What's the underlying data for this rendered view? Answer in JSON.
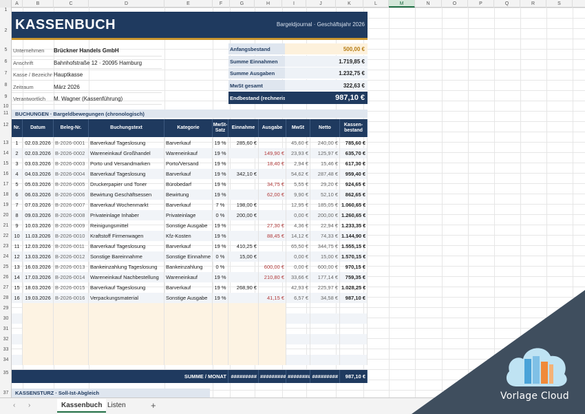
{
  "columns": [
    "A",
    "B",
    "C",
    "D",
    "E",
    "F",
    "G",
    "H",
    "I",
    "J",
    "K",
    "L",
    "M",
    "N",
    "O",
    "P",
    "Q",
    "R",
    "S"
  ],
  "active_column": "M",
  "rows_top": [
    "1",
    "2",
    "",
    "",
    "5",
    "6",
    "7",
    "8",
    "9",
    "10",
    "11",
    "12",
    "",
    "13",
    "14",
    "15",
    "16",
    "17",
    "18",
    "19",
    "20",
    "21",
    "22",
    "23",
    "24",
    "25",
    "26",
    "27",
    "28",
    "29",
    "30",
    "31",
    "32",
    "33",
    "34",
    "35",
    "",
    "37"
  ],
  "header": {
    "title": "KASSENBUCH",
    "subtitle": "Bargeldjournal · Geschäftsjahr 2026"
  },
  "info": [
    {
      "label": "Unternehmen",
      "value": "Brückner Handels GmbH",
      "bold": true
    },
    {
      "label": "Anschrift",
      "value": "Bahnhofstraße 12 · 20095 Hamburg",
      "bold": false
    },
    {
      "label": "Kasse / Bezeichn",
      "value": "Hauptkasse",
      "bold": false
    },
    {
      "label": "Zeitraum",
      "value": "März 2026",
      "bold": false
    },
    {
      "label": "Verantwortlich",
      "value": "M. Wagner (Kassenführung)",
      "bold": false
    }
  ],
  "summary": [
    {
      "label": "Anfangsbestand",
      "value": "500,00 €"
    },
    {
      "label": "Summe Einnahmen",
      "value": "1.719,85 €"
    },
    {
      "label": "Summe Ausgaben",
      "value": "1.232,75 €"
    },
    {
      "label": "MwSt gesamt",
      "value": "322,63 €"
    },
    {
      "label": "Endbestand (rechnerisch)",
      "value": "987,10 €"
    }
  ],
  "bookings_title": "BUCHUNGEN · Bargeldbewegungen (chronologisch)",
  "table_headers": [
    "Nr.",
    "Datum",
    "Beleg-Nr.",
    "Buchungstext",
    "Kategorie",
    "MwSt-Satz",
    "Einnahme",
    "Ausgabe",
    "MwSt",
    "Netto",
    "Kassen-bestand"
  ],
  "rows": [
    [
      "1",
      "02.03.2026",
      "B-2026-0001",
      "Barverkauf Tageslosung",
      "Barverkauf",
      "19 %",
      "285,60 €",
      "",
      "45,60 €",
      "240,00 €",
      "785,60 €"
    ],
    [
      "2",
      "02.03.2026",
      "B-2026-0002",
      "Wareneinkauf Großhandel",
      "Wareneinkauf",
      "19 %",
      "",
      "149,90 €",
      "23,93 €",
      "125,97 €",
      "635,70 €"
    ],
    [
      "3",
      "03.03.2026",
      "B-2026-0003",
      "Porto und Versandmarken",
      "Porto/Versand",
      "19 %",
      "",
      "18,40 €",
      "2,94 €",
      "15,46 €",
      "617,30 €"
    ],
    [
      "4",
      "04.03.2026",
      "B-2026-0004",
      "Barverkauf Tageslosung",
      "Barverkauf",
      "19 %",
      "342,10 €",
      "",
      "54,62 €",
      "287,48 €",
      "959,40 €"
    ],
    [
      "5",
      "05.03.2026",
      "B-2026-0005",
      "Druckerpapier und Toner",
      "Bürobedarf",
      "19 %",
      "",
      "34,75 €",
      "5,55 €",
      "29,20 €",
      "924,65 €"
    ],
    [
      "6",
      "06.03.2026",
      "B-2026-0006",
      "Bewirtung Geschäftsessen",
      "Bewirtung",
      "19 %",
      "",
      "62,00 €",
      "9,90 €",
      "52,10 €",
      "862,65 €"
    ],
    [
      "7",
      "07.03.2026",
      "B-2026-0007",
      "Barverkauf Wochenmarkt",
      "Barverkauf",
      "7 %",
      "198,00 €",
      "",
      "12,95 €",
      "185,05 €",
      "1.060,65 €"
    ],
    [
      "8",
      "09.03.2026",
      "B-2026-0008",
      "Privateinlage Inhaber",
      "Privateinlage",
      "0 %",
      "200,00 €",
      "",
      "0,00 €",
      "200,00 €",
      "1.260,65 €"
    ],
    [
      "9",
      "10.03.2026",
      "B-2026-0009",
      "Reinigungsmittel",
      "Sonstige Ausgabe",
      "19 %",
      "",
      "27,30 €",
      "4,36 €",
      "22,94 €",
      "1.233,35 €"
    ],
    [
      "10",
      "11.03.2026",
      "B-2026-0010",
      "Kraftstoff Firmenwagen",
      "Kfz-Kosten",
      "19 %",
      "",
      "88,45 €",
      "14,12 €",
      "74,33 €",
      "1.144,90 €"
    ],
    [
      "11",
      "12.03.2026",
      "B-2026-0011",
      "Barverkauf Tageslosung",
      "Barverkauf",
      "19 %",
      "410,25 €",
      "",
      "65,50 €",
      "344,75 €",
      "1.555,15 €"
    ],
    [
      "12",
      "13.03.2026",
      "B-2026-0012",
      "Sonstige Bareinnahme",
      "Sonstige Einnahme",
      "0 %",
      "15,00 €",
      "",
      "0,00 €",
      "15,00 €",
      "1.570,15 €"
    ],
    [
      "13",
      "16.03.2026",
      "B-2026-0013",
      "Bankeinzahlung Tageslosung",
      "Bankeinzahlung",
      "0 %",
      "",
      "600,00 €",
      "0,00 €",
      "600,00 €",
      "970,15 €"
    ],
    [
      "14",
      "17.03.2026",
      "B-2026-0014",
      "Wareneinkauf Nachbestellung",
      "Wareneinkauf",
      "19 %",
      "",
      "210,80 €",
      "33,66 €",
      "177,14 €",
      "759,35 €"
    ],
    [
      "15",
      "18.03.2026",
      "B-2026-0015",
      "Barverkauf Tageslosung",
      "Barverkauf",
      "19 %",
      "268,90 €",
      "",
      "42,93 €",
      "225,97 €",
      "1.028,25 €"
    ],
    [
      "16",
      "19.03.2026",
      "B-2026-0016",
      "Verpackungsmaterial",
      "Sonstige Ausgabe",
      "19 %",
      "",
      "41,15 €",
      "6,57 €",
      "34,58 €",
      "987,10 €"
    ]
  ],
  "totals": {
    "label": "SUMME / MONAT",
    "einnahme": "#########",
    "ausgabe": "#########",
    "mwst": "########",
    "netto": "#########",
    "bestand": "987,10 €"
  },
  "kassensturz_title": "KASSENSTURZ · Soll-Ist-Abgleich",
  "tabs": [
    {
      "label": "Kassenbuch",
      "active": true
    },
    {
      "label": "Listen",
      "active": false
    }
  ],
  "add_tab": "+",
  "nav": {
    "prev": "‹",
    "next": "›"
  },
  "watermark": "Vorlage Cloud",
  "colors": {
    "navy": "#1f3a5f",
    "gold": "#c8952f",
    "cream": "#fdf3e3",
    "expense_red": "#b23a3a",
    "excel_green": "#1f6e43"
  }
}
